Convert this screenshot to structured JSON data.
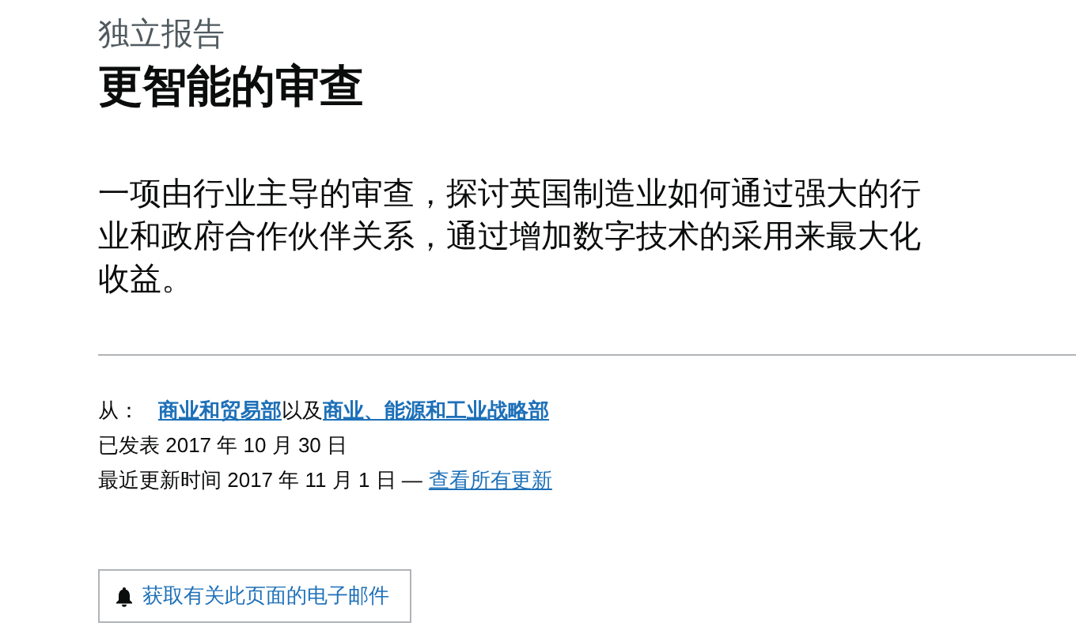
{
  "caption": "独立报告",
  "title": "更智能的审查",
  "description": "一项由行业主导的审查，探讨英国制造业如何通过强大的行业和政府合作伙伴关系，通过增加数字技术的采用来最大化收益。",
  "metadata": {
    "from_label": "从：",
    "organisations": [
      "商业和贸易部",
      "商业、能源和工业战略部"
    ],
    "joiner": "以及",
    "published": "已发表 2017 年 10 月 30 日",
    "updated": "最近更新时间 2017 年 11 月 1 日 —",
    "updates_link": "查看所有更新"
  },
  "email_button": "获取有关此页面的电子邮件"
}
